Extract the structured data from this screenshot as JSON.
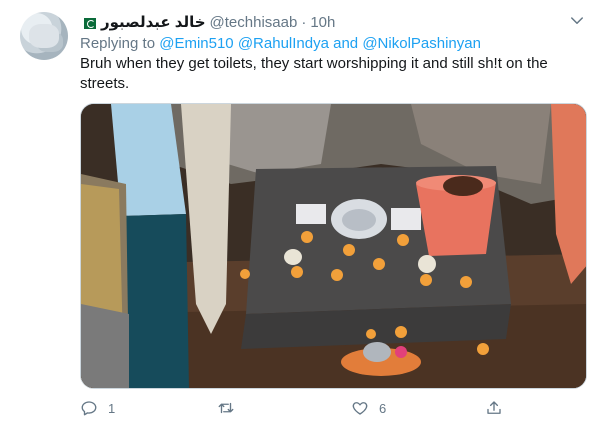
{
  "tweet": {
    "display_name": "خالد عبدلصبور",
    "handle": "@techhisaab",
    "separator": "·",
    "time": "10h",
    "replying_prefix": "Replying to",
    "replying_to": [
      "@Emin510",
      "@RahulIndya",
      "@NikolPashinyan"
    ],
    "replying_and": "and",
    "text": "Bruh when they get toilets, they start worshipping it and still sh!t on the streets."
  },
  "actions": {
    "reply_count": "1",
    "retweet_count": "",
    "like_count": "6"
  },
  "icons": {
    "avatar": "avatar",
    "flag": "pakistan-flag-icon",
    "more": "chevron-down-icon",
    "reply": "reply-icon",
    "retweet": "retweet-icon",
    "like": "heart-icon",
    "share": "share-icon"
  },
  "colors": {
    "link": "#1da1f2",
    "muted": "#657786",
    "text": "#14171a"
  }
}
